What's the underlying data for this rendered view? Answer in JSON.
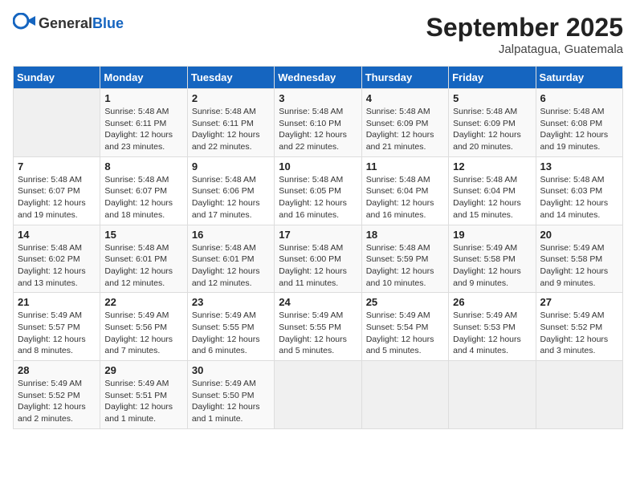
{
  "header": {
    "logo_general": "General",
    "logo_blue": "Blue",
    "month_title": "September 2025",
    "location": "Jalpatagua, Guatemala"
  },
  "days_of_week": [
    "Sunday",
    "Monday",
    "Tuesday",
    "Wednesday",
    "Thursday",
    "Friday",
    "Saturday"
  ],
  "weeks": [
    [
      {
        "day": "",
        "empty": true
      },
      {
        "day": "1",
        "sunrise": "5:48 AM",
        "sunset": "6:11 PM",
        "daylight": "12 hours and 23 minutes."
      },
      {
        "day": "2",
        "sunrise": "5:48 AM",
        "sunset": "6:11 PM",
        "daylight": "12 hours and 22 minutes."
      },
      {
        "day": "3",
        "sunrise": "5:48 AM",
        "sunset": "6:10 PM",
        "daylight": "12 hours and 22 minutes."
      },
      {
        "day": "4",
        "sunrise": "5:48 AM",
        "sunset": "6:09 PM",
        "daylight": "12 hours and 21 minutes."
      },
      {
        "day": "5",
        "sunrise": "5:48 AM",
        "sunset": "6:09 PM",
        "daylight": "12 hours and 20 minutes."
      },
      {
        "day": "6",
        "sunrise": "5:48 AM",
        "sunset": "6:08 PM",
        "daylight": "12 hours and 19 minutes."
      }
    ],
    [
      {
        "day": "7",
        "sunrise": "5:48 AM",
        "sunset": "6:07 PM",
        "daylight": "12 hours and 19 minutes."
      },
      {
        "day": "8",
        "sunrise": "5:48 AM",
        "sunset": "6:07 PM",
        "daylight": "12 hours and 18 minutes."
      },
      {
        "day": "9",
        "sunrise": "5:48 AM",
        "sunset": "6:06 PM",
        "daylight": "12 hours and 17 minutes."
      },
      {
        "day": "10",
        "sunrise": "5:48 AM",
        "sunset": "6:05 PM",
        "daylight": "12 hours and 16 minutes."
      },
      {
        "day": "11",
        "sunrise": "5:48 AM",
        "sunset": "6:04 PM",
        "daylight": "12 hours and 16 minutes."
      },
      {
        "day": "12",
        "sunrise": "5:48 AM",
        "sunset": "6:04 PM",
        "daylight": "12 hours and 15 minutes."
      },
      {
        "day": "13",
        "sunrise": "5:48 AM",
        "sunset": "6:03 PM",
        "daylight": "12 hours and 14 minutes."
      }
    ],
    [
      {
        "day": "14",
        "sunrise": "5:48 AM",
        "sunset": "6:02 PM",
        "daylight": "12 hours and 13 minutes."
      },
      {
        "day": "15",
        "sunrise": "5:48 AM",
        "sunset": "6:01 PM",
        "daylight": "12 hours and 12 minutes."
      },
      {
        "day": "16",
        "sunrise": "5:48 AM",
        "sunset": "6:01 PM",
        "daylight": "12 hours and 12 minutes."
      },
      {
        "day": "17",
        "sunrise": "5:48 AM",
        "sunset": "6:00 PM",
        "daylight": "12 hours and 11 minutes."
      },
      {
        "day": "18",
        "sunrise": "5:48 AM",
        "sunset": "5:59 PM",
        "daylight": "12 hours and 10 minutes."
      },
      {
        "day": "19",
        "sunrise": "5:49 AM",
        "sunset": "5:58 PM",
        "daylight": "12 hours and 9 minutes."
      },
      {
        "day": "20",
        "sunrise": "5:49 AM",
        "sunset": "5:58 PM",
        "daylight": "12 hours and 9 minutes."
      }
    ],
    [
      {
        "day": "21",
        "sunrise": "5:49 AM",
        "sunset": "5:57 PM",
        "daylight": "12 hours and 8 minutes."
      },
      {
        "day": "22",
        "sunrise": "5:49 AM",
        "sunset": "5:56 PM",
        "daylight": "12 hours and 7 minutes."
      },
      {
        "day": "23",
        "sunrise": "5:49 AM",
        "sunset": "5:55 PM",
        "daylight": "12 hours and 6 minutes."
      },
      {
        "day": "24",
        "sunrise": "5:49 AM",
        "sunset": "5:55 PM",
        "daylight": "12 hours and 5 minutes."
      },
      {
        "day": "25",
        "sunrise": "5:49 AM",
        "sunset": "5:54 PM",
        "daylight": "12 hours and 5 minutes."
      },
      {
        "day": "26",
        "sunrise": "5:49 AM",
        "sunset": "5:53 PM",
        "daylight": "12 hours and 4 minutes."
      },
      {
        "day": "27",
        "sunrise": "5:49 AM",
        "sunset": "5:52 PM",
        "daylight": "12 hours and 3 minutes."
      }
    ],
    [
      {
        "day": "28",
        "sunrise": "5:49 AM",
        "sunset": "5:52 PM",
        "daylight": "12 hours and 2 minutes."
      },
      {
        "day": "29",
        "sunrise": "5:49 AM",
        "sunset": "5:51 PM",
        "daylight": "12 hours and 1 minute."
      },
      {
        "day": "30",
        "sunrise": "5:49 AM",
        "sunset": "5:50 PM",
        "daylight": "12 hours and 1 minute."
      },
      {
        "day": "",
        "empty": true
      },
      {
        "day": "",
        "empty": true
      },
      {
        "day": "",
        "empty": true
      },
      {
        "day": "",
        "empty": true
      }
    ]
  ]
}
